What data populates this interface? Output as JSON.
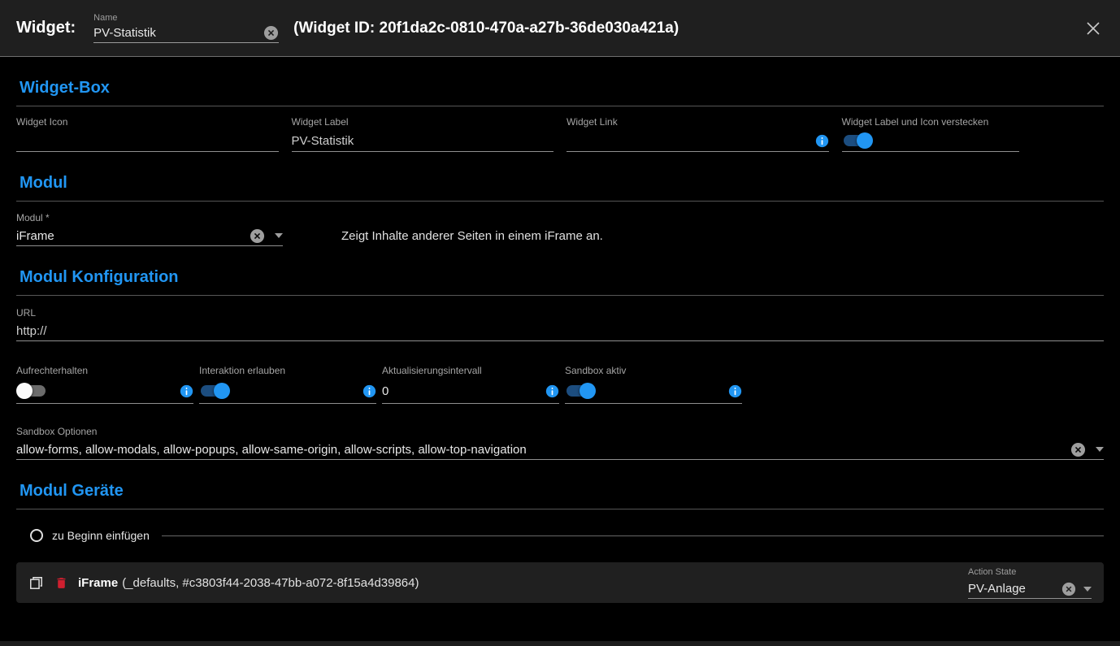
{
  "header": {
    "title": "Widget:",
    "name_field": {
      "label": "Name",
      "value": "PV-Statistik"
    },
    "widget_id": "(Widget ID: 20f1da2c-0810-470a-a27b-36de030a421a)"
  },
  "sections": {
    "widget_box": {
      "heading": "Widget-Box",
      "widget_icon": {
        "label": "Widget Icon",
        "value": ""
      },
      "widget_label": {
        "label": "Widget Label",
        "value": "PV-Statistik"
      },
      "widget_link": {
        "label": "Widget Link",
        "value": ""
      },
      "hide_label_icon": {
        "label": "Widget Label und Icon verstecken",
        "state": "on"
      }
    },
    "modul": {
      "heading": "Modul",
      "modul_field": {
        "label": "Modul *",
        "value": "iFrame"
      },
      "description": "Zeigt Inhalte anderer Seiten in einem iFrame an."
    },
    "modul_konfiguration": {
      "heading": "Modul Konfiguration",
      "url_field": {
        "label": "URL",
        "value": "http://"
      },
      "aufrechterhalten": {
        "label": "Aufrechterhalten",
        "state": "off"
      },
      "interaktion_erlauben": {
        "label": "Interaktion erlauben",
        "state": "on"
      },
      "aktualisierungsintervall": {
        "label": "Aktualisierungsintervall",
        "value": "0"
      },
      "sandbox_aktiv": {
        "label": "Sandbox aktiv",
        "state": "on"
      },
      "sandbox_optionen": {
        "label": "Sandbox Optionen",
        "value": "allow-forms, allow-modals, allow-popups, allow-same-origin, allow-scripts, allow-top-navigation"
      }
    },
    "modul_geraete": {
      "heading": "Modul Geräte",
      "insert_radio_label": "zu Beginn einfügen",
      "device": {
        "name": "iFrame",
        "detail": "(_defaults, #c3803f44-2038-47bb-a072-8f15a4d39864)",
        "action_state": {
          "label": "Action State",
          "value": "PV-Anlage"
        }
      }
    }
  },
  "colors": {
    "accent": "#2196f3",
    "danger": "#cf1f2f",
    "header_bg": "#1f1f1f",
    "background": "#000000"
  }
}
